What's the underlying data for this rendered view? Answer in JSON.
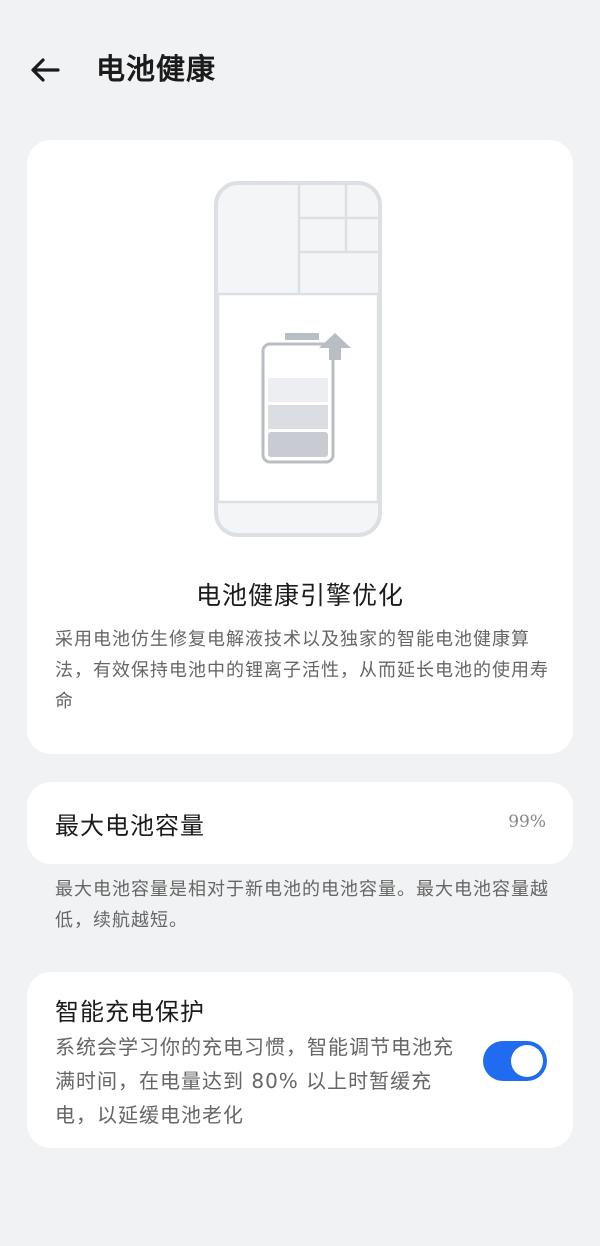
{
  "header": {
    "back_icon": "arrow-left-icon",
    "title": "电池健康"
  },
  "engine": {
    "illustration": "phone-battery-illustration",
    "title": "电池健康引擎优化",
    "description": "采用电池仿生修复电解液技术以及独家的智能电池健康算法，有效保持电池中的锂离子活性，从而延长电池的使用寿命"
  },
  "capacity": {
    "label": "最大电池容量",
    "value": "99%",
    "note": "最大电池容量是相对于新电池的电池容量。最大电池容量越低，续航越短。"
  },
  "smart_charge": {
    "title": "智能充电保护",
    "description": "系统会学习你的充电习惯，智能调节电池充满时间，在电量达到 80% 以上时暂缓充电，以延缓电池老化",
    "enabled": true
  },
  "colors": {
    "background": "#f1f2f4",
    "card": "#ffffff",
    "accent": "#1f6cf0",
    "text_primary": "#1b1b1b",
    "text_secondary": "#666666"
  }
}
